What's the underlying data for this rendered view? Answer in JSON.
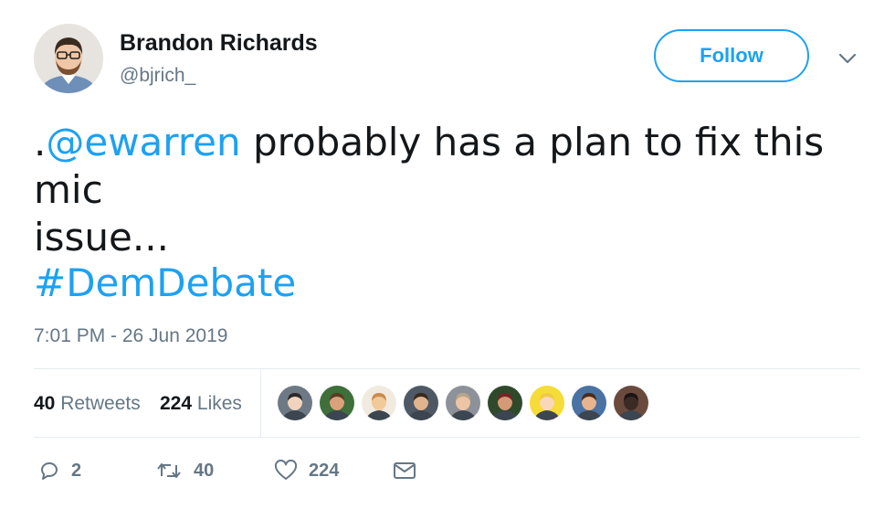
{
  "user": {
    "display_name": "Brandon Richards",
    "handle": "@bjrich_",
    "follow_label": "Follow"
  },
  "tweet": {
    "prefix": ".",
    "mention": "@ewarren",
    "text_line1_rest": " probably has a plan to fix this mic",
    "text_line2": "issue...",
    "hashtag": "#DemDebate",
    "timestamp": "7:01 PM - 26 Jun 2019"
  },
  "stats": {
    "retweets_count": "40",
    "retweets_label": "Retweets",
    "likes_count": "224",
    "likes_label": "Likes"
  },
  "likers": [
    {
      "name": "liker-1",
      "bg": "#6d7a86",
      "skin": "#f2d3bd",
      "hair": "#2b2a2a"
    },
    {
      "name": "liker-2",
      "bg": "#3f6f3a",
      "skin": "#d9a27c",
      "hair": "#5a3d24"
    },
    {
      "name": "liker-3",
      "bg": "#f1eadf",
      "skin": "#f1c99a",
      "hair": "#c98d4a"
    },
    {
      "name": "liker-4",
      "bg": "#4e5965",
      "skin": "#e0b48f",
      "hair": "#3a2a1e"
    },
    {
      "name": "liker-5",
      "bg": "#8d9199",
      "skin": "#edc5a6",
      "hair": "#b8a58a"
    },
    {
      "name": "liker-6",
      "bg": "#2e4a2a",
      "skin": "#d39a75",
      "hair": "#7a2323"
    },
    {
      "name": "liker-7",
      "bg": "#f6dc38",
      "skin": "#f8d8b9",
      "hair": "#f0c946"
    },
    {
      "name": "liker-8",
      "bg": "#4a72a3",
      "skin": "#e6b48e",
      "hair": "#4b2c1a"
    },
    {
      "name": "liker-9",
      "bg": "#6b4a3e",
      "skin": "#3a2b25",
      "hair": "#1a1413"
    }
  ],
  "actions": {
    "reply_count": "2",
    "retweet_count": "40",
    "like_count": "224"
  },
  "colors": {
    "accent": "#1da1f2",
    "muted": "#657786",
    "text": "#14171a",
    "divider": "#e6ecf0"
  }
}
